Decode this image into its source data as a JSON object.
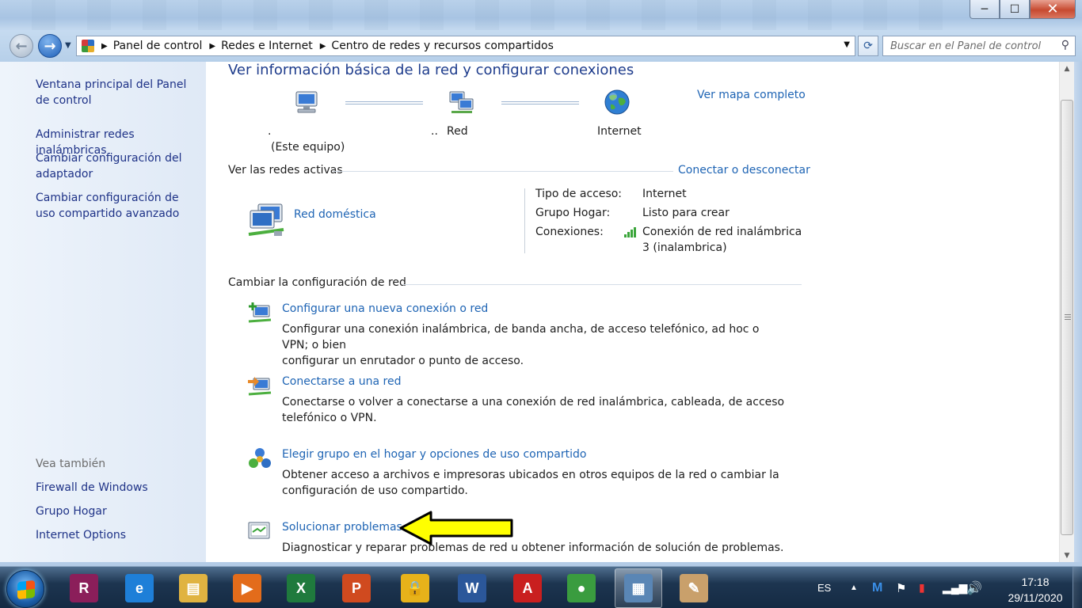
{
  "window": {
    "minimize_glyph": "─",
    "maximize_glyph": "☐",
    "close_glyph": "✕"
  },
  "nav": {
    "breadcrumbs": [
      "Panel de control",
      "Redes e Internet",
      "Centro de redes y recursos compartidos"
    ],
    "search_placeholder": "Buscar en el Panel de control",
    "back_glyph": "←",
    "forward_glyph": "→",
    "refresh_glyph": "⟳",
    "search_glyph": "⚲"
  },
  "sidebar": {
    "items": [
      {
        "label": "Ventana principal del Panel de control"
      },
      {
        "label": "Administrar redes inalámbricas"
      },
      {
        "label": "Cambiar configuración del adaptador"
      },
      {
        "label": "Cambiar configuración de uso compartido avanzado"
      }
    ],
    "see_also_heading": "Vea también",
    "see_also": [
      {
        "label": "Firewall de Windows"
      },
      {
        "label": "Grupo Hogar"
      },
      {
        "label": "Internet Options"
      }
    ]
  },
  "main": {
    "title": "Ver información básica de la red y configurar conexiones",
    "map_link": "Ver mapa completo",
    "network_map": {
      "computer_name": ".",
      "computer_label": "(Este equipo)",
      "network_prefix": "..",
      "network_label": "Red",
      "internet_label": "Internet"
    },
    "active": {
      "heading": "Ver las redes activas",
      "connect_link": "Conectar o desconectar",
      "network_name": "Red doméstica",
      "access_type_label": "Tipo de acceso:",
      "access_type_value": "Internet",
      "homegroup_label": "Grupo Hogar:",
      "homegroup_value": "Listo para crear",
      "connections_label": "Conexiones:",
      "connections_value_line1": "Conexión de red inalámbrica",
      "connections_value_line2": "3 (inalambrica)"
    },
    "change": {
      "heading": "Cambiar la configuración de red",
      "tasks": [
        {
          "title": "Configurar una nueva conexión o red",
          "desc_line1": "Configurar una conexión inalámbrica, de banda ancha, de acceso telefónico, ad hoc o VPN; o bien",
          "desc_line2": "configurar un enrutador o punto de acceso."
        },
        {
          "title": "Conectarse a una red",
          "desc_line1": "Conectarse o volver a conectarse a una conexión de red inalámbrica, cableada, de acceso",
          "desc_line2": "telefónico o VPN."
        },
        {
          "title": "Elegir grupo en el hogar y opciones de uso compartido",
          "desc_line1": "Obtener acceso a archivos e impresoras ubicados en otros equipos de la red o cambiar la",
          "desc_line2": "configuración de uso compartido."
        },
        {
          "title": "Solucionar problemas",
          "desc_line1": "Diagnosticar y reparar problemas de red u obtener información de solución de problemas."
        }
      ]
    }
  },
  "annotation": {
    "arrow_color": "#ffff00"
  },
  "taskbar": {
    "apps": [
      {
        "name": "winrar",
        "glyph": "R",
        "color": "#8b1e5a"
      },
      {
        "name": "internet-explorer",
        "glyph": "e",
        "color": "#1e7fd8"
      },
      {
        "name": "explorer",
        "glyph": "▤",
        "color": "#e0b341"
      },
      {
        "name": "media-player",
        "glyph": "▶",
        "color": "#e36c1b"
      },
      {
        "name": "excel",
        "glyph": "X",
        "color": "#1f7a3d"
      },
      {
        "name": "powerpoint",
        "glyph": "P",
        "color": "#d04a1f"
      },
      {
        "name": "vpn",
        "glyph": "🔒",
        "color": "#e7b21a"
      },
      {
        "name": "word",
        "glyph": "W",
        "color": "#2b579a"
      },
      {
        "name": "acrobat",
        "glyph": "A",
        "color": "#c91f1f"
      },
      {
        "name": "chrome",
        "glyph": "●",
        "color": "#3a9c3f"
      },
      {
        "name": "network-center",
        "glyph": "▦",
        "color": "#5a86b5"
      },
      {
        "name": "paint",
        "glyph": "✎",
        "color": "#c9a06b"
      }
    ],
    "language": "ES",
    "time": "17:18",
    "date": "29/11/2020"
  }
}
